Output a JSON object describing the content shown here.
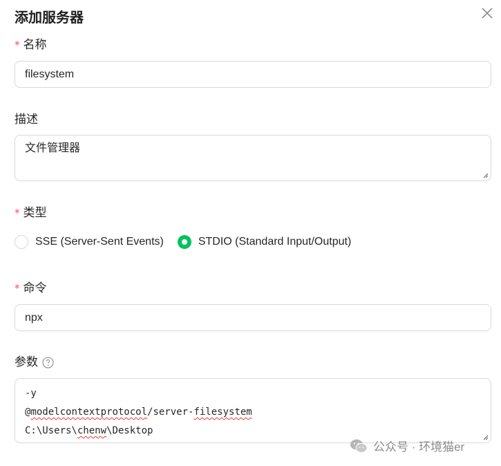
{
  "dialog": {
    "title": "添加服务器"
  },
  "form": {
    "name": {
      "label": "名称",
      "required_mark": "*",
      "value": "filesystem"
    },
    "description": {
      "label": "描述",
      "value": "文件管理器"
    },
    "type": {
      "label": "类型",
      "required_mark": "*",
      "options": [
        {
          "label": "SSE (Server-Sent Events)",
          "selected": false
        },
        {
          "label": "STDIO (Standard Input/Output)",
          "selected": true
        }
      ]
    },
    "command": {
      "label": "命令",
      "required_mark": "*",
      "value": "npx"
    },
    "args": {
      "label": "参数",
      "lines": [
        {
          "text": "-y"
        },
        {
          "prefix": "@",
          "word1": "modelcontextprotocol",
          "mid": "/server-",
          "word2": "filesystem"
        },
        {
          "prefix": "C:\\Users\\",
          "word1": "chenw",
          "mid": "\\Desktop"
        }
      ]
    }
  },
  "watermark": {
    "text": "公众号 · 环境猫er"
  },
  "colors": {
    "accent": "#07c160",
    "required": "#ff4d4f",
    "border": "#d9d9d9"
  }
}
